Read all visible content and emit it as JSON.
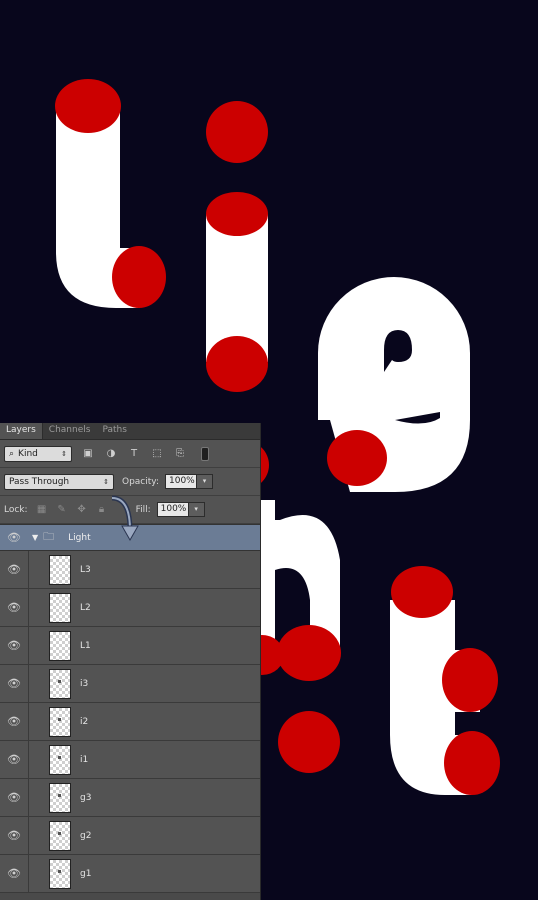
{
  "canvas": {
    "background": "#08061c",
    "shape_color": "#ffffff",
    "cap_color": "#cc0000"
  },
  "panel": {
    "tabs": [
      "Layers",
      "Channels",
      "Paths"
    ],
    "filter": {
      "label": "Kind"
    },
    "filter_icons": [
      "image-filter-icon",
      "adjustment-filter-icon",
      "type-filter-icon",
      "shape-filter-icon",
      "smart-object-filter-icon"
    ],
    "blend_mode": "Pass Through",
    "opacity_label": "Opacity:",
    "opacity_value": "100%",
    "lock_label": "Lock:",
    "fill_label": "Fill:",
    "fill_value": "100%",
    "group": {
      "name": "Light"
    },
    "layers": [
      {
        "name": "L3"
      },
      {
        "name": "L2"
      },
      {
        "name": "L1"
      },
      {
        "name": "i3"
      },
      {
        "name": "i2"
      },
      {
        "name": "i1"
      },
      {
        "name": "g3"
      },
      {
        "name": "g2"
      },
      {
        "name": "g1"
      }
    ]
  }
}
